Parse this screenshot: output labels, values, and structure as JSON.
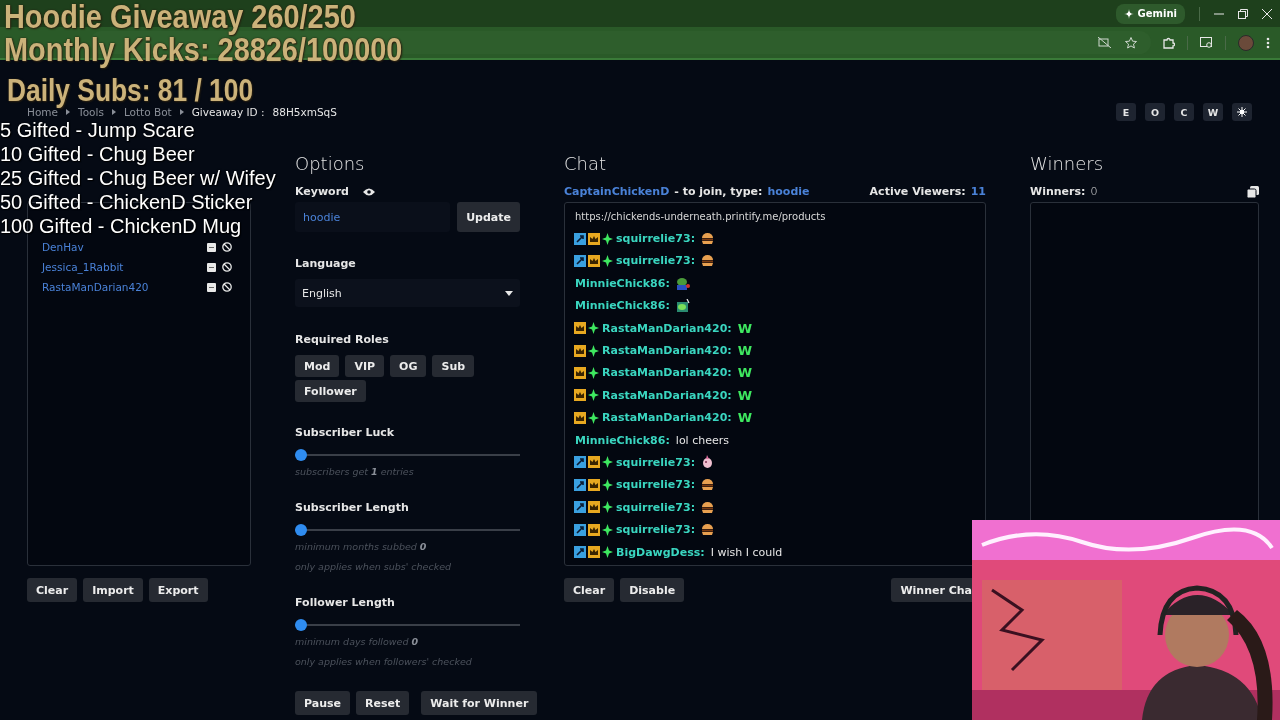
{
  "browser": {
    "gemini_button": "Gemini"
  },
  "breadcrumb": {
    "items": [
      "Home",
      "Tools",
      "Lotto Bot"
    ],
    "label": "Giveaway ID :",
    "value": "88H5xmSqS"
  },
  "view_buttons": [
    "E",
    "O",
    "C",
    "W"
  ],
  "entries": {
    "items": [
      "DenHav",
      "Jessica_1Rabbit",
      "RastaManDarian420"
    ],
    "buttons": [
      "Clear",
      "Import",
      "Export"
    ]
  },
  "options": {
    "title": "Options",
    "keyword": {
      "label": "Keyword",
      "value": "hoodie",
      "button": "Update"
    },
    "language": {
      "label": "Language",
      "value": "English"
    },
    "roles": {
      "label": "Required Roles",
      "items": [
        "Mod",
        "VIP",
        "OG",
        "Sub",
        "Follower"
      ]
    },
    "sliders": [
      {
        "label": "Subscriber Luck",
        "level": 0,
        "hints": [
          "subscribers get **1** entries"
        ]
      },
      {
        "label": "Subscriber Length",
        "level": 0,
        "hints": [
          "minimum months subbed **0**",
          "only applies when subs' checked"
        ]
      },
      {
        "label": "Follower Length",
        "level": 0,
        "hints": [
          "minimum days followed **0**",
          "only applies when followers' checked"
        ]
      }
    ],
    "buttons": [
      "Pause",
      "Reset",
      "Wait for Winner"
    ]
  },
  "chat": {
    "title": "Chat",
    "channel": "CaptainChickenD",
    "join_text": "- to join, type:",
    "keyword": "hoodie",
    "viewers_label": "Active Viewers:",
    "viewers": "11",
    "messages": [
      {
        "kind": "text",
        "text": "https://chickends-underneath.printify.me/products"
      },
      {
        "moderator": true,
        "subscriber": true,
        "og": true,
        "user": "squirrelie73:",
        "kind": "burger"
      },
      {
        "moderator": true,
        "subscriber": true,
        "og": true,
        "user": "squirrelie73:",
        "kind": "burger"
      },
      {
        "moderator": false,
        "subscriber": false,
        "og": false,
        "user": "MinnieChick86:",
        "kind": "frog"
      },
      {
        "moderator": false,
        "subscriber": false,
        "og": false,
        "user": "MinnieChick86:",
        "kind": "sign"
      },
      {
        "moderator": false,
        "subscriber": true,
        "og": true,
        "user": "RastaManDarian420:",
        "kind": "big",
        "text": "W"
      },
      {
        "moderator": false,
        "subscriber": true,
        "og": true,
        "user": "RastaManDarian420:",
        "kind": "big",
        "text": "W"
      },
      {
        "moderator": false,
        "subscriber": true,
        "og": true,
        "user": "RastaManDarian420:",
        "kind": "big",
        "text": "W"
      },
      {
        "moderator": false,
        "subscriber": true,
        "og": true,
        "user": "RastaManDarian420:",
        "kind": "big",
        "text": "W"
      },
      {
        "moderator": false,
        "subscriber": true,
        "og": true,
        "user": "RastaManDarian420:",
        "kind": "big",
        "text": "W"
      },
      {
        "moderator": false,
        "subscriber": false,
        "og": false,
        "user": "MinnieChick86:",
        "kind": "text",
        "text": "lol cheers"
      },
      {
        "moderator": true,
        "subscriber": true,
        "og": true,
        "user": "squirrelie73:",
        "kind": "unicorn"
      },
      {
        "moderator": true,
        "subscriber": true,
        "og": true,
        "user": "squirrelie73:",
        "kind": "burger"
      },
      {
        "moderator": true,
        "subscriber": true,
        "og": true,
        "user": "squirrelie73:",
        "kind": "burger"
      },
      {
        "moderator": true,
        "subscriber": true,
        "og": true,
        "user": "squirrelie73:",
        "kind": "burger"
      },
      {
        "moderator": true,
        "subscriber": true,
        "og": true,
        "user": "BigDawgDess:",
        "kind": "text",
        "text": "I wish I could"
      }
    ],
    "buttons": [
      "Clear",
      "Disable",
      "Winner Cha"
    ]
  },
  "winners": {
    "title": "Winners",
    "count_label": "Winners:",
    "count": "0"
  },
  "overlay": {
    "goals": [
      "Hoodie Giveaway 260/250",
      "Monthly Kicks: 28826/100000",
      "Daily Subs:  81 / 100"
    ],
    "rewards": [
      "5 Gifted - Jump Scare",
      "10 Gifted - Chug Beer",
      "25 Gifted - Chug Beer w/ Wifey",
      "50 Gifted - ChickenD Sticker",
      "100 Gifted - ChickenD Mug"
    ]
  },
  "webcam": {
    "kind": "picture"
  }
}
